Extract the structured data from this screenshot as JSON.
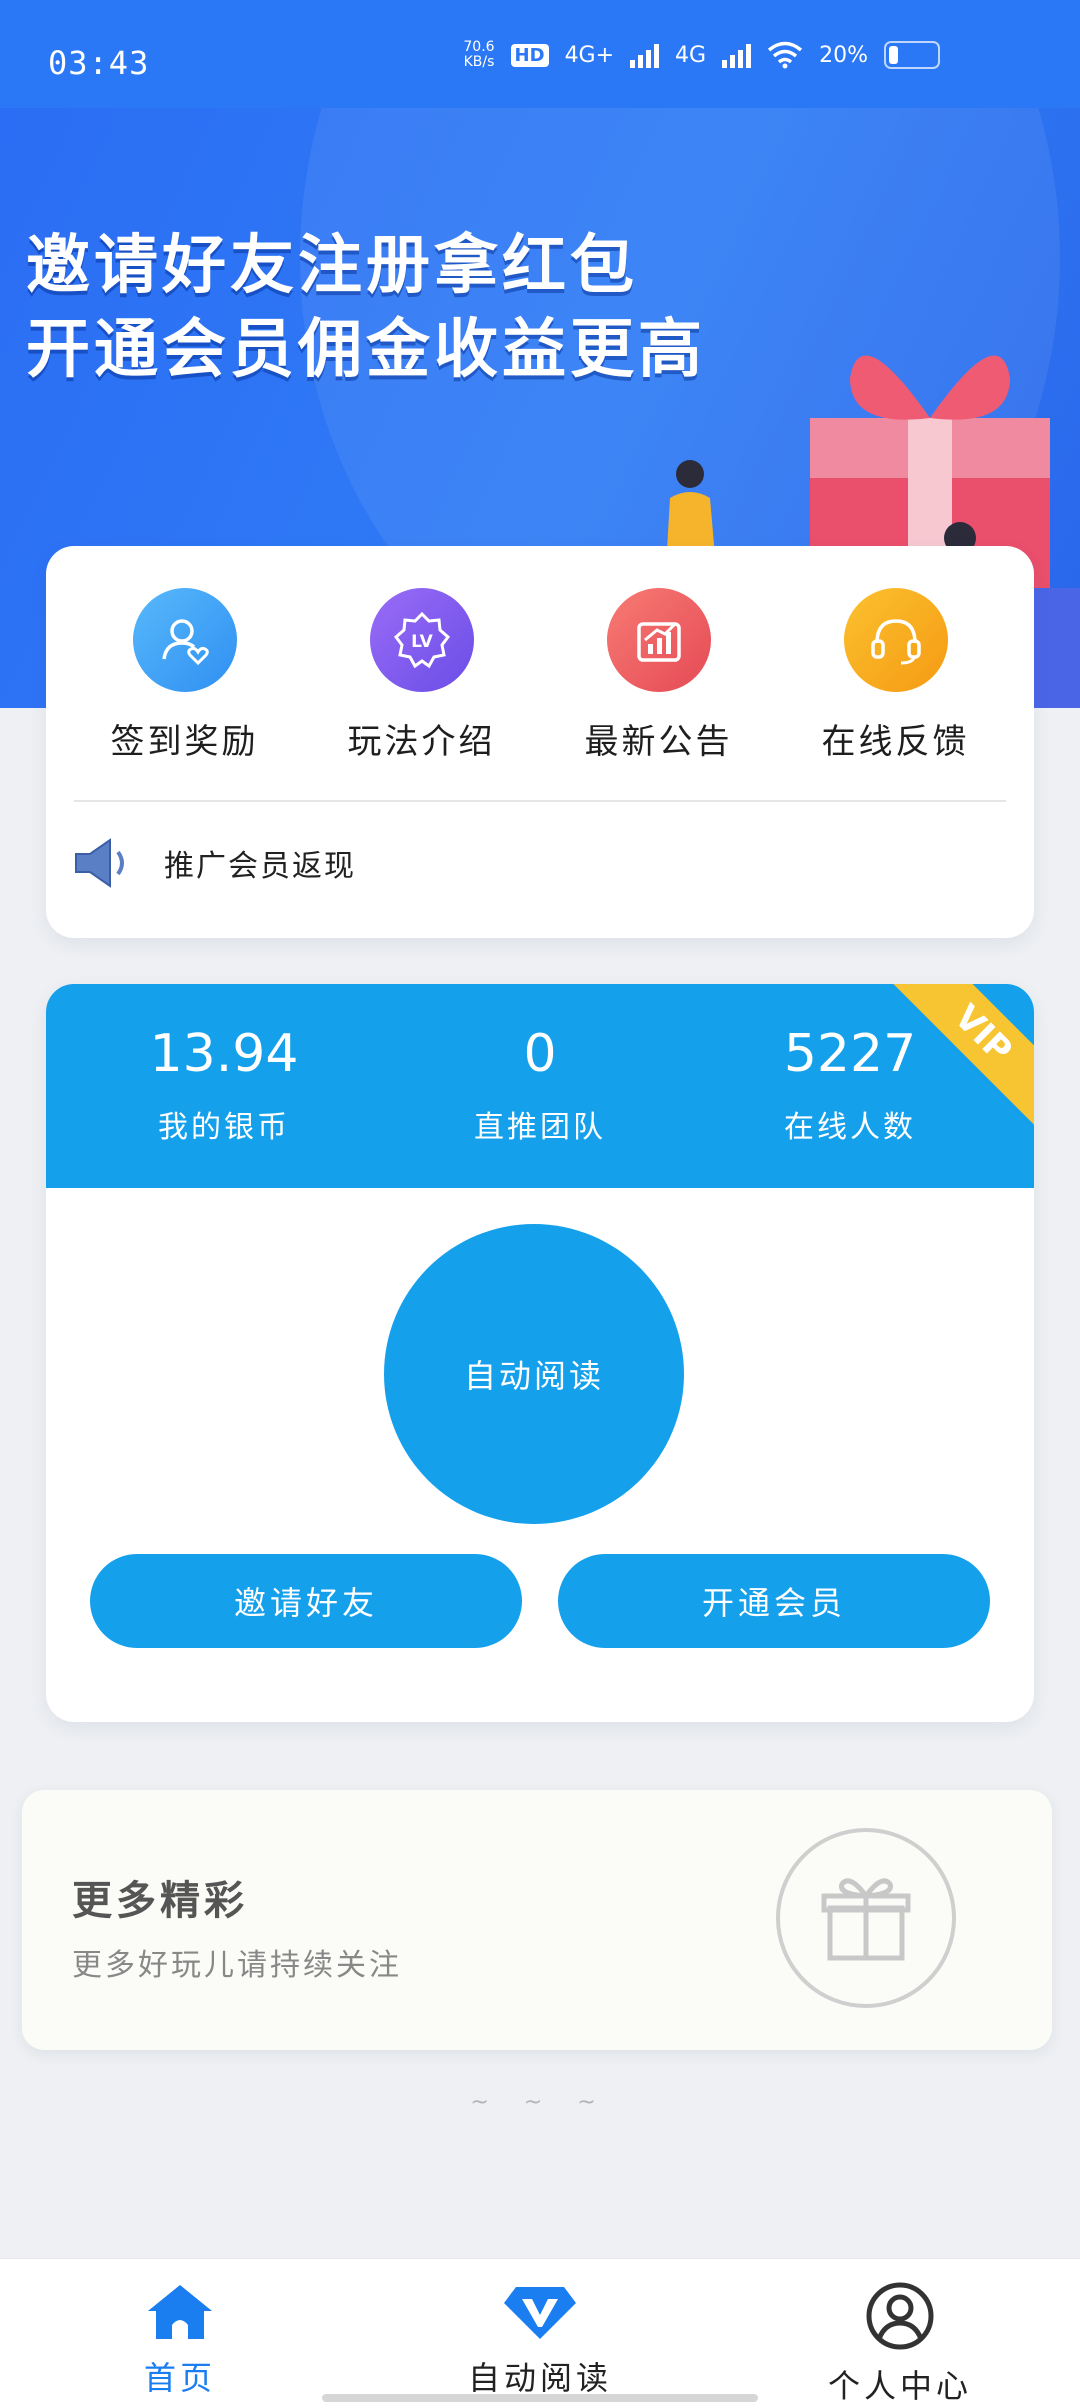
{
  "status_bar": {
    "time": "03:43",
    "net_speed_value": "70.6",
    "net_speed_unit": "KB/s",
    "hd_label": "HD",
    "sim1": "4G+",
    "sim2": "4G",
    "battery_percent": "20%",
    "battery_level": 0.2
  },
  "banner": {
    "line1": "邀请好友注册拿红包",
    "line2": "开通会员佣金收益更高"
  },
  "quick_menu": {
    "items": [
      {
        "label": "签到奖励",
        "icon": "user-heart-icon",
        "color": "#3a9ff5"
      },
      {
        "label": "玩法介绍",
        "icon": "lv-badge-icon",
        "color": "#7a5cf0"
      },
      {
        "label": "最新公告",
        "icon": "chart-icon",
        "color": "#ef5b5b"
      },
      {
        "label": "在线反馈",
        "icon": "headset-icon",
        "color": "#f6a41c"
      }
    ],
    "notice": "推广会员返现"
  },
  "stats": {
    "items": [
      {
        "value": "13.94",
        "label": "我的银币"
      },
      {
        "value": "0",
        "label": "直推团队"
      },
      {
        "value": "5227",
        "label": "在线人数"
      }
    ],
    "vip_badge": "VIP",
    "auto_read_button": "自动阅读",
    "invite_button": "邀请好友",
    "member_button": "开通会员",
    "accent": "#15a0ec"
  },
  "more": {
    "title": "更多精彩",
    "subtitle": "更多好玩儿请持续关注"
  },
  "footer_mark": "~ ~ ~",
  "tab_bar": {
    "tabs": [
      {
        "label": "首页",
        "active": true
      },
      {
        "label": "自动阅读",
        "active": false
      },
      {
        "label": "个人中心",
        "active": false
      }
    ],
    "active_color": "#1a7ef0"
  }
}
